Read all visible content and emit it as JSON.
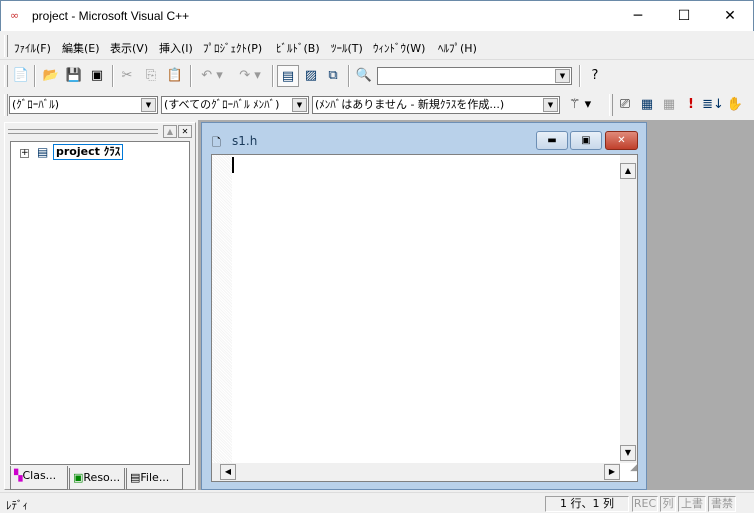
{
  "title": "project - Microsoft Visual C++",
  "menu": [
    "ﾌｧｲﾙ(F)",
    "編集(E)",
    "表示(V)",
    "挿入(I)",
    "ﾌﾟﾛｼﾞｪｸﾄ(P)",
    "ﾋﾞﾙﾄﾞ(B)",
    "ﾂｰﾙ(T)",
    "ｳｨﾝﾄﾞｳ(W)",
    "ﾍﾙﾌﾟ(H)"
  ],
  "toolbar": {
    "find_value": ""
  },
  "wizardbar": {
    "scope": "(ｸﾞﾛｰﾊﾞﾙ)",
    "members": "(すべてのｸﾞﾛｰﾊﾞﾙ ﾒﾝﾊﾞ)",
    "action": "(ﾒﾝﾊﾞはありません - 新規ｸﾗｽを作成...)"
  },
  "workspace": {
    "tree_root": "project ｸﾗｽ",
    "tabs": [
      "Clas...",
      "Reso...",
      "File..."
    ]
  },
  "child": {
    "title": "s1.h"
  },
  "status": {
    "text": "ﾚﾃﾞｨ",
    "position": "1 行、1 列",
    "rec": "REC",
    "col": "列",
    "ovr": "上書",
    "read": "書禁"
  }
}
